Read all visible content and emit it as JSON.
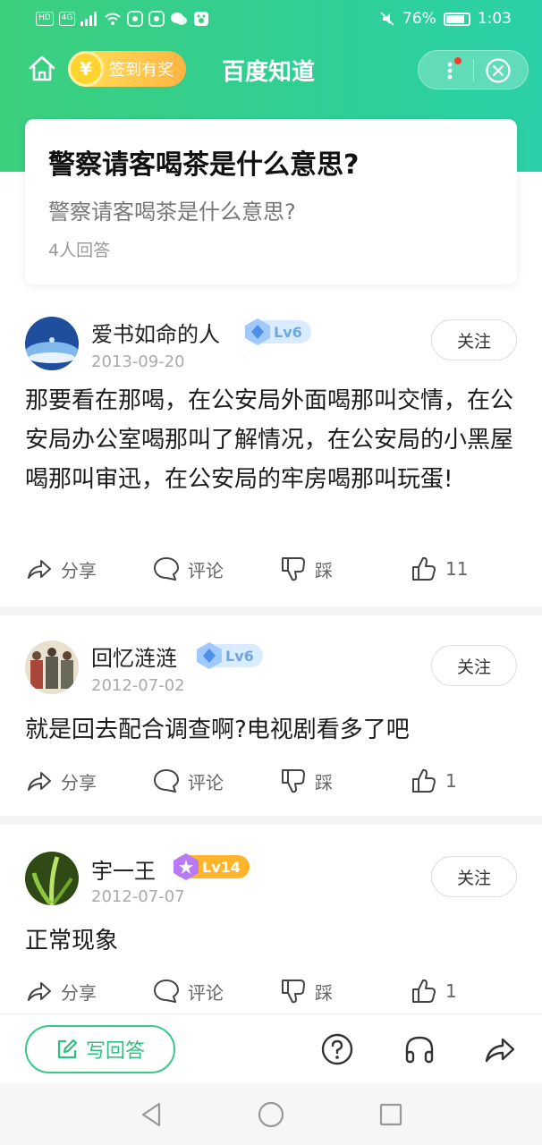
{
  "status_bar": {
    "left_chips": [
      "HD",
      "4G"
    ],
    "battery": "76%",
    "time": "1:03"
  },
  "nav": {
    "sign_in_label": "签到有奖",
    "coin_symbol": "¥",
    "brand": "百度知道"
  },
  "question": {
    "title": "警察请客喝茶是什么意思?",
    "description": "警察请客喝茶是什么意思?",
    "answer_count": "4人回答"
  },
  "answers": [
    {
      "user": "爱书如命的人",
      "level": "Lv6",
      "date": "2013-09-20",
      "follow": "关注",
      "text": "那要看在那喝，在公安局外面喝那叫交情，在公安局办公室喝那叫了解情况，在公安局的小黑屋喝那叫审迅，在公安局的牢房喝那叫玩蛋!",
      "share": "分享",
      "comment": "评论",
      "dislike": "踩",
      "likes": "11"
    },
    {
      "user": "回忆涟涟",
      "level": "Lv6",
      "date": "2012-07-02",
      "follow": "关注",
      "text": "就是回去配合调查啊?电视剧看多了吧",
      "share": "分享",
      "comment": "评论",
      "dislike": "踩",
      "likes": "1"
    },
    {
      "user": "宇一王",
      "level": "Lv14",
      "date": "2012-07-07",
      "follow": "关注",
      "text": "正常现象",
      "share": "分享",
      "comment": "评论",
      "dislike": "踩",
      "likes": "1"
    }
  ],
  "bottom_bar": {
    "write_answer": "写回答",
    "icons": [
      "question-icon",
      "headphones-icon",
      "share-icon"
    ]
  },
  "colors": {
    "header_green": "#3ccf7e",
    "accent_green": "#2fbf80",
    "coin_yellow": "#ffd42e",
    "level_gold": "#ffb429"
  }
}
